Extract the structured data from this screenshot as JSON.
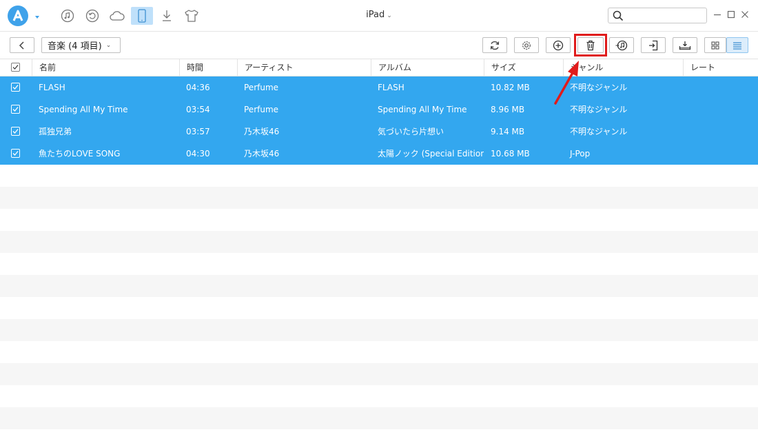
{
  "app": {
    "device_name": "iPad"
  },
  "nav_icons": [
    {
      "name": "music-note-icon",
      "active": false
    },
    {
      "name": "history-icon",
      "active": false
    },
    {
      "name": "cloud-icon",
      "active": false
    },
    {
      "name": "tablet-device-icon",
      "active": true
    },
    {
      "name": "download-icon",
      "active": false
    },
    {
      "name": "shirt-icon",
      "active": false
    }
  ],
  "search": {
    "placeholder": "",
    "value": ""
  },
  "toolbar": {
    "category_label": "音楽 (4 項目)",
    "buttons": [
      "refresh",
      "settings",
      "add",
      "delete",
      "to-itunes",
      "export",
      "to-device",
      "grid-view",
      "list-view"
    ],
    "active_view": "list-view",
    "highlighted_button": "delete"
  },
  "table": {
    "columns": [
      "名前",
      "時間",
      "アーティスト",
      "アルバム",
      "サイズ",
      "ジャンル",
      "レート"
    ],
    "rows": [
      {
        "name": "FLASH",
        "time": "04:36",
        "artist": "Perfume",
        "album": "FLASH",
        "size": "10.82 MB",
        "genre": "不明なジャンル",
        "rate": "",
        "checked": true
      },
      {
        "name": "Spending All My Time",
        "time": "03:54",
        "artist": "Perfume",
        "album": "Spending All My Time",
        "size": "8.96 MB",
        "genre": "不明なジャンル",
        "rate": "",
        "checked": true
      },
      {
        "name": "孤独兄弟",
        "time": "03:57",
        "artist": "乃木坂46",
        "album": "気づいたら片想い",
        "size": "9.14 MB",
        "genre": "不明なジャンル",
        "rate": "",
        "checked": true
      },
      {
        "name": "魚たちのLOVE SONG",
        "time": "04:30",
        "artist": "乃木坂46",
        "album": "太陽ノック (Special Edition)",
        "size": "10.68 MB",
        "genre": "J-Pop",
        "rate": "",
        "checked": true
      }
    ]
  },
  "colors": {
    "accent": "#33a7ef",
    "highlight_box": "#e01b1b",
    "active_nav": "#bfe0fa"
  }
}
